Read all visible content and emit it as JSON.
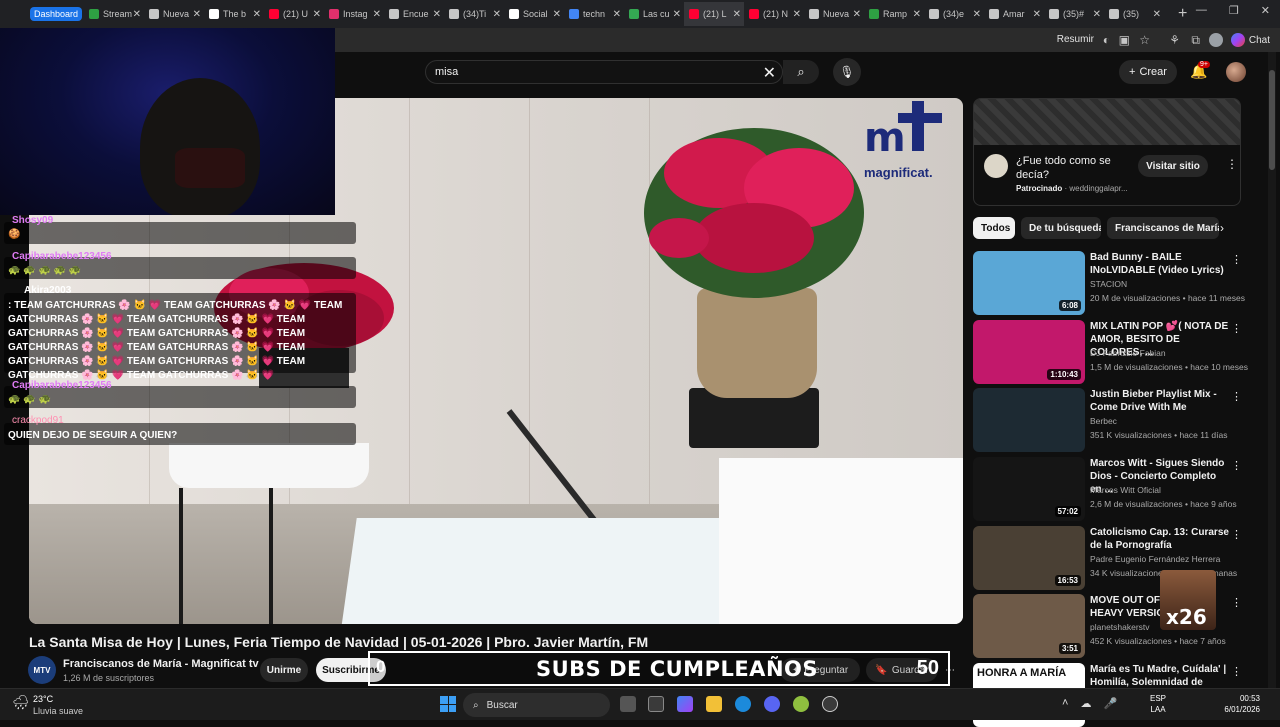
{
  "browser": {
    "tabs": [
      {
        "label": "Dashboard",
        "color": "#1a73e8",
        "active": false
      },
      {
        "label": "Stream",
        "color": "#2ea043"
      },
      {
        "label": "Nueva",
        "color": "#c7c7c7"
      },
      {
        "label": "The b",
        "color": "#ffffff"
      },
      {
        "label": "(21) U",
        "color": "#ff0033"
      },
      {
        "label": "Instag",
        "color": "#e1306c"
      },
      {
        "label": "Encue",
        "color": "#c7c7c7"
      },
      {
        "label": "(34)Ti",
        "color": "#c7c7c7"
      },
      {
        "label": "Social",
        "color": "#ffffff"
      },
      {
        "label": "techn",
        "color": "#4285f4"
      },
      {
        "label": "Las cu",
        "color": "#34a853"
      },
      {
        "label": "(21) L",
        "color": "#ff0033",
        "active": true
      },
      {
        "label": "(21) N",
        "color": "#ff0033"
      },
      {
        "label": "Nueva",
        "color": "#c7c7c7"
      },
      {
        "label": "Ramp",
        "color": "#2ea043"
      },
      {
        "label": "(34)e",
        "color": "#c7c7c7"
      },
      {
        "label": "Amar",
        "color": "#c7c7c7"
      },
      {
        "label": "(35)#",
        "color": "#c7c7c7"
      },
      {
        "label": "(35)",
        "color": "#c7c7c7"
      }
    ],
    "toolbar": {
      "resumir_label": "Resumir",
      "chat_label": "Chat"
    }
  },
  "youtube": {
    "search": {
      "value": "misa"
    },
    "create_label": "Crear",
    "notifications_badge": "9+",
    "video": {
      "title": "La Santa Misa de Hoy | Lunes, Feria Tiempo de Navidad | 05-01-2026 | Pbro. Javier Martín, FM",
      "channel": "Franciscanos de María - Magnificat tv",
      "channel_avatar_text": "MTV",
      "subscribers": "1,26 M de suscriptores",
      "join_label": "Unirme",
      "subscribe_label": "Suscribirme",
      "ask_label": "Preguntar",
      "save_label": "Guardar",
      "logo_word": "magnificat."
    },
    "ad": {
      "title": "¿Fue todo como se decía?",
      "sponsored_label": "Patrocinado",
      "sponsor_domain": "weddinggalapr...",
      "visit_label": "Visitar sitio"
    },
    "chips": [
      "Todos",
      "De tu búsqueda",
      "Franciscanos de María"
    ],
    "recommendations": [
      {
        "title": "Bad Bunny - BAILE INoLVIDABLE (Video Lyrics)",
        "channel": "STACION",
        "meta": "20 M de visualizaciones • hace 11 meses",
        "duration": "6:08",
        "thumb": "#5aa7d6"
      },
      {
        "title": "MIX LATIN POP 💕( NOTA DE AMOR, BESITO DE COLORES, ...",
        "channel": "DJ Fabrizzio Fabian",
        "meta": "1,5 M de visualizaciones • hace 10 meses",
        "duration": "1:10:43",
        "thumb": "#c2186b"
      },
      {
        "title": "Justin Bieber Playlist Mix - Come Drive With Me",
        "channel": "Berbec",
        "meta": "351 K visualizaciones • hace 11 días",
        "duration": "",
        "thumb": "#1d2a33"
      },
      {
        "title": "Marcos Witt - Sigues Siendo Dios - Concierto Completo en ...",
        "channel": "Marcos Witt Oficial",
        "meta": "2,6 M de visualizaciones • hace 9 años",
        "duration": "57:02",
        "thumb": "#151515"
      },
      {
        "title": "Catolicismo Cap. 13: Curarse de la Pornografía",
        "channel": "Padre Eugenio Fernández Herrera",
        "meta": "34 K visualizaciones • hace 1 semanas",
        "duration": "16:53",
        "thumb": "#4a4034"
      },
      {
        "title": "MOVE OUT OF MY WAY HEAVY VERSION",
        "channel": "planetshakerstv",
        "meta": "452 K visualizaciones • hace 7 años",
        "duration": "3:51",
        "thumb": "#6e5a48"
      },
      {
        "title": "María es Tu Madre, Cuídala' | Homilía, Solemnidad de Santa ...",
        "channel": "",
        "meta": "",
        "duration": "",
        "thumb": "#ffffff",
        "thumb_text": "HONRA A MARÍA"
      }
    ]
  },
  "chat": {
    "messages": [
      {
        "user": "Shosy09",
        "user_color": "#e07cf5",
        "text": "",
        "emoji": "🍪"
      },
      {
        "user": "Capibarabebe123456",
        "user_color": "#e07cf5",
        "text": "",
        "emoji": "🐢 🐢 🐢 🐢 🐢"
      },
      {
        "user": "Akira2003",
        "user_color": "#ffffff",
        "text": ": TEAM GATCHURRAS 🌸 🐱 💗 TEAM GATCHURRAS 🌸 🐱 💗 TEAM GATCHURRAS 🌸 🐱 💗 TEAM GATCHURRAS 🌸 🐱 💗 TEAM GATCHURRAS 🌸 🐱 💗 TEAM GATCHURRAS 🌸 🐱 💗 TEAM GATCHURRAS 🌸 🐱 💗 TEAM GATCHURRAS 🌸 🐱 💗 TEAM GATCHURRAS 🌸 🐱 💗 TEAM GATCHURRAS 🌸 🐱 💗 TEAM GATCHURRAS 🌸 🐱 💗 TEAM GATCHURRAS 🌸 🐱 💗",
        "emoji": ""
      },
      {
        "user": "Capibarabebe123456",
        "user_color": "#e07cf5",
        "text": "",
        "emoji": "🐢 🐢 🐢"
      },
      {
        "user": "crackpod91",
        "user_color": "#ff8fb1",
        "text": "QUIEN DEJO DE SEGUIR A QUIEN?",
        "emoji": ""
      }
    ]
  },
  "overlay": {
    "birthday_text": "SUBS DE CUMPLEAÑOS",
    "left_count": "0",
    "right_count": "50",
    "multiplier": "x26"
  },
  "taskbar": {
    "weather_temp": "23°C",
    "weather_desc": "Lluvia suave",
    "search_label": "Buscar",
    "lang_top": "ESP",
    "lang_bottom": "LAA",
    "time": "00:53",
    "date": "6/01/2026"
  }
}
